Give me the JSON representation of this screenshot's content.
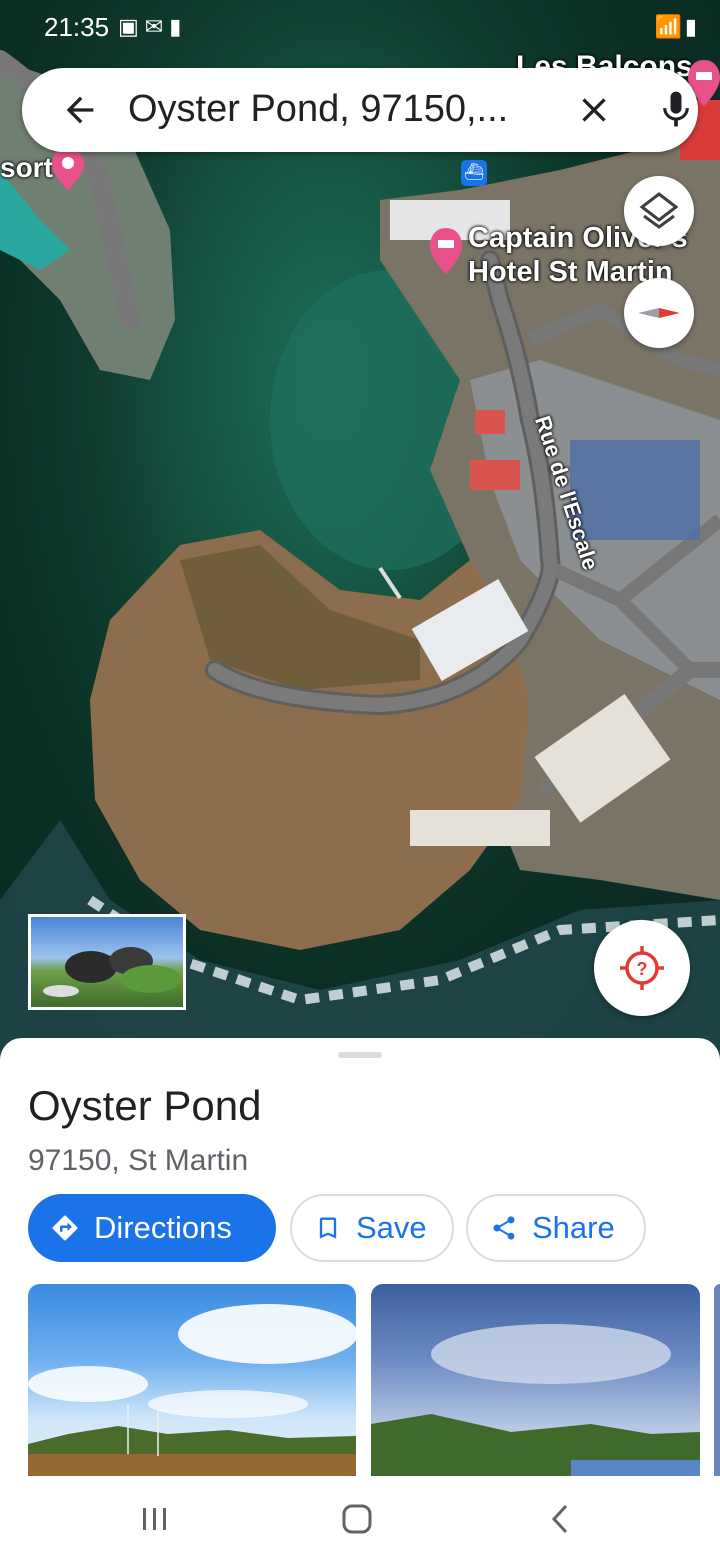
{
  "status_bar": {
    "time": "21:35"
  },
  "search": {
    "query": "Oyster Pond, 97150,..."
  },
  "map": {
    "labels": {
      "resort": "sort",
      "balcons": "Les Balcons",
      "hotel_line1": "Captain Oliver's",
      "hotel_line2": "Hotel St Martin",
      "street": "Rue de l'Escale"
    }
  },
  "place": {
    "name": "Oyster Pond",
    "address": "97150, St Martin"
  },
  "actions": {
    "directions": "Directions",
    "save": "Save",
    "share": "Share"
  },
  "colors": {
    "accent": "#1a73e8",
    "map_water": "#0f3a2e",
    "land": "#8a6a4a",
    "road": "#6b6b6b"
  }
}
